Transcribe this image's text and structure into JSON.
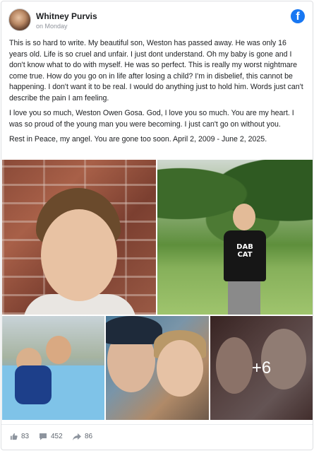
{
  "post": {
    "author": "Whitney Purvis",
    "date": "on Monday",
    "paragraphs": [
      "This is so hard to write. My beautiful son, Weston has passed away. He was only 16 years old. Life is so cruel and unfair. I just dont understand. Oh my baby is gone and I don't know what to do with myself. He was so perfect. This is really my worst nightmare come true. How do you go on in life after losing a child? I'm in disbelief, this cannot be happening. I don't want it to be real. I would do anything just to hold him. Words just can't describe the pain I am feeling.",
      "I love you so much, Weston Owen Gosa. God, I love you so much. You are my heart. I was so proud of the young man you were becoming. I just can't go on without you.",
      "Rest in Peace, my angel. You are gone too soon. April 2, 2009 - June 2, 2025."
    ]
  },
  "photos": {
    "shirt_text_line1": "DAB",
    "shirt_text_line2": "CAT",
    "more_count": "+6"
  },
  "stats": {
    "likes": "83",
    "comments": "452",
    "shares": "86"
  },
  "icons": {
    "brand": "facebook-logo-icon",
    "like": "thumbs-up-icon",
    "comment": "comment-bubble-icon",
    "share": "share-arrow-icon"
  },
  "colors": {
    "brand": "#1877f2",
    "muted": "#90949c"
  }
}
